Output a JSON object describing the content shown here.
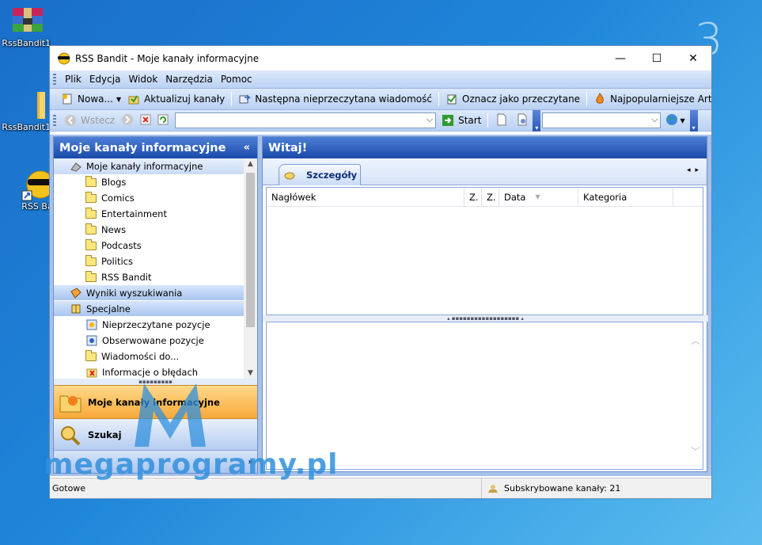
{
  "desktop": {
    "icons": [
      {
        "label": "RssBandit1.",
        "icon": "winrar-archive-icon"
      },
      {
        "label": "RssBandit1.",
        "icon": "folder-icon"
      },
      {
        "label": "RSS Ba",
        "icon": "rss-bandit-shortcut-icon"
      }
    ],
    "window_number": "3"
  },
  "window": {
    "title": "RSS Bandit - Moje kanały informacyjne",
    "controls": {
      "minimize": "—",
      "maximize": "☐",
      "close": "✕"
    }
  },
  "menu": [
    "Plik",
    "Edycja",
    "Widok",
    "Narzędzia",
    "Pomoc"
  ],
  "toolbar": {
    "new": "Nowa...",
    "update": "Aktualizuj kanały",
    "next_unread": "Następna nieprzeczytana wiadomość",
    "mark_read": "Oznacz jako przeczytane",
    "popular": "Najpopularniejsze Artykuły"
  },
  "navbar": {
    "back": "Wstecz",
    "address_value": "",
    "start": "Start",
    "search_value": ""
  },
  "left_pane": {
    "title": "Moje kanały informacyjne",
    "collapse": "«",
    "tree": [
      {
        "label": "Moje kanały informacyjne",
        "type": "root",
        "icon": "feeds-root-icon",
        "selected": true
      },
      {
        "label": "Blogs",
        "type": "folder"
      },
      {
        "label": "Comics",
        "type": "folder"
      },
      {
        "label": "Entertainment",
        "type": "folder"
      },
      {
        "label": "News",
        "type": "folder"
      },
      {
        "label": "Podcasts",
        "type": "folder"
      },
      {
        "label": "Politics",
        "type": "folder"
      },
      {
        "label": "RSS Bandit",
        "type": "folder"
      },
      {
        "label": "Wyniki wyszukiwania",
        "type": "group",
        "icon": "search-results-icon"
      },
      {
        "label": "Specjalne",
        "type": "group",
        "icon": "special-book-icon"
      },
      {
        "label": "Nieprzeczytane pozycje",
        "type": "special",
        "icon": "unread-items-icon"
      },
      {
        "label": "Obserwowane pozycje",
        "type": "special",
        "icon": "watched-items-icon"
      },
      {
        "label": "Wiadomości do...",
        "type": "folder"
      },
      {
        "label": "Informacje o błędach",
        "type": "special",
        "icon": "error-info-icon"
      }
    ],
    "nav_buttons": {
      "feeds": "Moje kanały informacyjne",
      "search": "Szukaj",
      "more": "»"
    }
  },
  "right_pane": {
    "title": "Witaj!",
    "tab": "Szczegóły",
    "columns": [
      "Nagłówek",
      "Z.",
      "Z.",
      "Data",
      "Kategoria"
    ]
  },
  "status": {
    "left": "Gotowe",
    "right": "Subskrybowane kanały: 21"
  },
  "watermark": "megaprogramy.pl",
  "colors": {
    "header_blue": "#1a4aa9",
    "active_orange": "#f7a93a",
    "watermark_blue": "#2f8fdd"
  }
}
